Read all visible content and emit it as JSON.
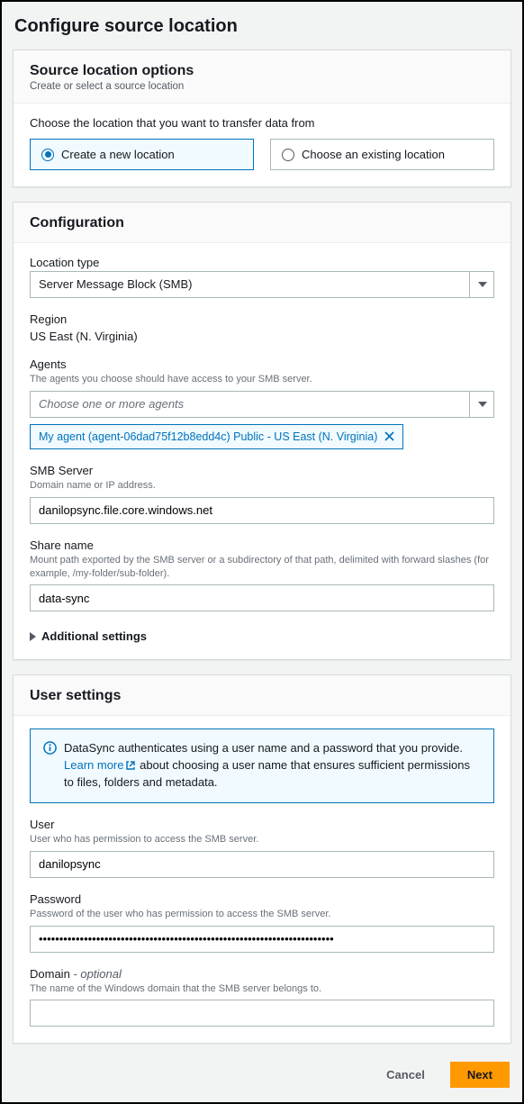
{
  "page": {
    "title": "Configure source location"
  },
  "sourceOptions": {
    "title": "Source location options",
    "subtitle": "Create or select a source location",
    "chooseText": "Choose the location that you want to transfer data from",
    "createLabel": "Create a new location",
    "existingLabel": "Choose an existing location"
  },
  "configuration": {
    "title": "Configuration",
    "locationType": {
      "label": "Location type",
      "value": "Server Message Block (SMB)"
    },
    "region": {
      "label": "Region",
      "value": "US East (N. Virginia)"
    },
    "agents": {
      "label": "Agents",
      "hint": "The agents you choose should have access to your SMB server.",
      "placeholder": "Choose one or more agents",
      "selected": "My agent (agent-06dad75f12b8edd4c)   Public - US East (N. Virginia)"
    },
    "smbServer": {
      "label": "SMB Server",
      "hint": "Domain name or IP address.",
      "value": "danilopsync.file.core.windows.net"
    },
    "shareName": {
      "label": "Share name",
      "hint": "Mount path exported by the SMB server or a subdirectory of that path, delimited with forward slashes (for example, /my-folder/sub-folder).",
      "value": "data-sync"
    },
    "additional": "Additional settings"
  },
  "userSettings": {
    "title": "User settings",
    "info": {
      "textBefore": "DataSync authenticates using a user name and a password that you provide. ",
      "learnMore": "Learn more",
      "textAfter": " about choosing a user name that ensures sufficient permissions to files, folders and metadata."
    },
    "user": {
      "label": "User",
      "hint": "User who has permission to access the SMB server.",
      "value": "danilopsync"
    },
    "password": {
      "label": "Password",
      "hint": "Password of the user who has permission to access the SMB server.",
      "value": "••••••••••••••••••••••••••••••••••••••••••••••••••••••••••••••••••••••••"
    },
    "domain": {
      "label": "Domain",
      "optional": " - optional",
      "hint": "The name of the Windows domain that the SMB server belongs to.",
      "value": ""
    }
  },
  "footer": {
    "cancel": "Cancel",
    "next": "Next"
  }
}
